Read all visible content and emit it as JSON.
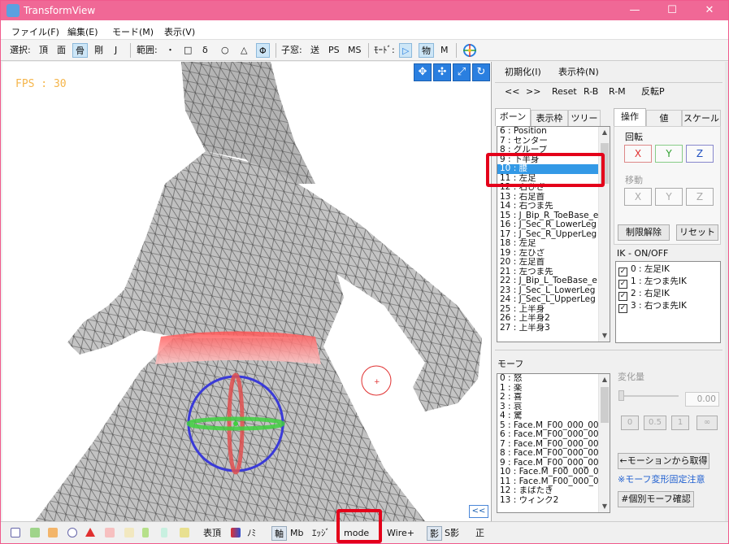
{
  "window": {
    "title": "TransformView",
    "minimize": "—",
    "maximize": "☐",
    "close": "✕"
  },
  "menu": [
    "ファイル(F)",
    "編集(E)",
    "モード(M)",
    "表示(V)"
  ],
  "toolbar": {
    "select_label": "選択:",
    "select_items": [
      "頂",
      "面",
      "骨",
      "剛",
      "J"
    ],
    "range_label": "範囲:",
    "range_items": [
      "・",
      "□",
      "δ",
      "○",
      "△",
      "Φ"
    ],
    "child_label": "子窓:",
    "child_items": [
      "送",
      "PS",
      "MS"
    ],
    "mode_label": "ﾓｰﾄﾞ:",
    "mode_items": [
      "▷",
      "物",
      "M"
    ]
  },
  "viewport": {
    "fps": "FPS : 30",
    "collapse_label": "<<",
    "nav_icons": [
      "move-cross-icon",
      "move-arrows-icon",
      "scale-arrow-icon",
      "rotate-icon"
    ]
  },
  "panel": {
    "init_label": "初期化(I)",
    "display_label": "表示枠(N)",
    "nav_buttons": [
      "<<",
      ">>",
      "Reset",
      "R-B",
      "R-M",
      "反転P"
    ],
    "bone_tabs": [
      "ボーン",
      "表示枠",
      "ツリー"
    ],
    "op_tabs": [
      "操作",
      "値",
      "スケール"
    ],
    "bones": [
      "6 : Position",
      "7 : センター",
      "8 : グルーブ",
      "9 : 下半身",
      "10 : 腰",
      "11 : 左足",
      "12 : 右ひざ",
      "13 : 右足首",
      "14 : 右つま先",
      "15 : J_Bip_R_ToeBase_e",
      "16 : J_Sec_R_LowerLeg",
      "17 : J_Sec_R_UpperLeg",
      "18 : 左足",
      "19 : 左ひざ",
      "20 : 左足首",
      "21 : 左つま先",
      "22 : J_Bip_L_ToeBase_e",
      "23 : J_Sec_L_LowerLeg",
      "24 : J_Sec_L_UpperLeg",
      "25 : 上半身",
      "26 : 上半身2",
      "27 : 上半身3"
    ],
    "selected_bone_index": 4,
    "rotate_label": "回転",
    "move_label": "移動",
    "axes": [
      "X",
      "Y",
      "Z"
    ],
    "limit_release": "制限解除",
    "reset": "リセット",
    "ik_title": "IK - ON/OFF",
    "ik_items": [
      "0 : 左足IK",
      "1 : 左つま先IK",
      "2 : 右足IK",
      "3 : 右つま先IK"
    ],
    "morph_title": "モーフ",
    "morphs": [
      "0 : 怒",
      "1 : 楽",
      "2 : 喜",
      "3 : 哀",
      "4 : 驚",
      "5 : Face.M_F00_000_00_",
      "6 : Face.M_F00_000_00_",
      "7 : Face.M_F00_000_00_",
      "8 : Face.M_F00_000_00_",
      "9 : Face.M_F00_000_00_",
      "10 : Face.M_F00_000_00",
      "11 : Face.M_F00_000_00",
      "12 : まばたき",
      "13 : ウィンク2"
    ],
    "change_label": "変化量",
    "change_value": "0.00",
    "preset_buttons": [
      "0",
      "0.5",
      "1",
      "∞"
    ],
    "from_motion": "←モーションから取得",
    "morph_note": "※モーフ変形固定注意",
    "individual_check": "#個別モーフ確認"
  },
  "bottom": {
    "labels": [
      "表頂",
      "ﾉﾐ",
      "軸",
      "Mb",
      "ｴｯｼﾞ",
      "mode",
      "Wire+",
      "影",
      "S影",
      "正"
    ]
  },
  "colors": {
    "title_bar": "#f06896",
    "selection": "#3399e6",
    "highlight_box": "#e4001a",
    "x_axis": "#e03030",
    "y_axis": "#30a030",
    "z_axis": "#2050c0"
  }
}
